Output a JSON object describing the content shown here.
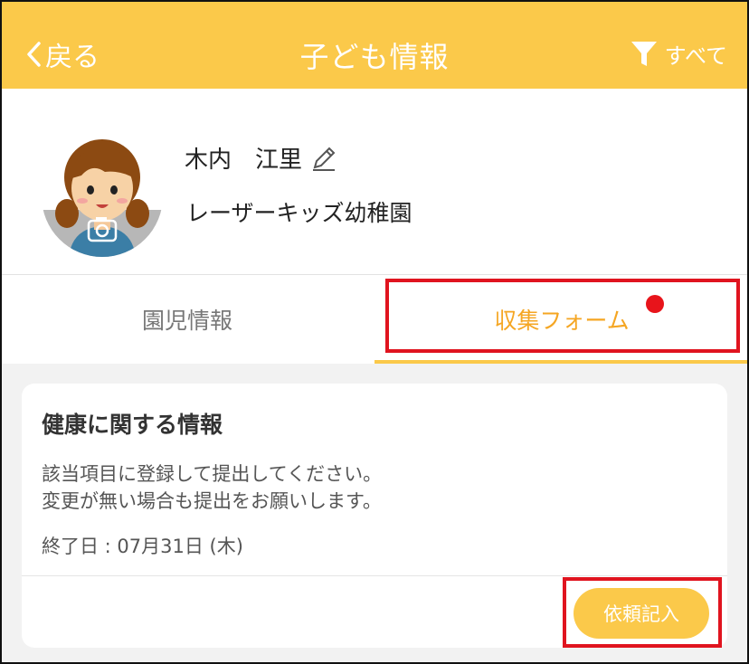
{
  "header": {
    "back_label": "戻る",
    "title": "子ども情報",
    "filter_label": "すべて",
    "background_color": "#fbc94a"
  },
  "profile": {
    "name": "木内　江里",
    "school": "レーザーキッズ幼稚園",
    "avatar_icon": "girl-avatar",
    "camera_icon": "camera-icon",
    "edit_icon": "pencil-icon"
  },
  "tabs": [
    {
      "label": "園児情報",
      "active": false
    },
    {
      "label": "収集フォーム",
      "active": true,
      "has_notification": true
    }
  ],
  "card": {
    "title": "健康に関する情報",
    "description_line1": "該当項目に登録して提出してください。",
    "description_line2": "変更が無い場合も提出をお願いします。",
    "end_date": "終了日 : 07月31日 (木)",
    "button_label": "依頼記入"
  },
  "colors": {
    "accent": "#fbc94a",
    "active_tab_text": "#f5a623",
    "highlight": "#e0141f",
    "notification": "#e8141b"
  }
}
